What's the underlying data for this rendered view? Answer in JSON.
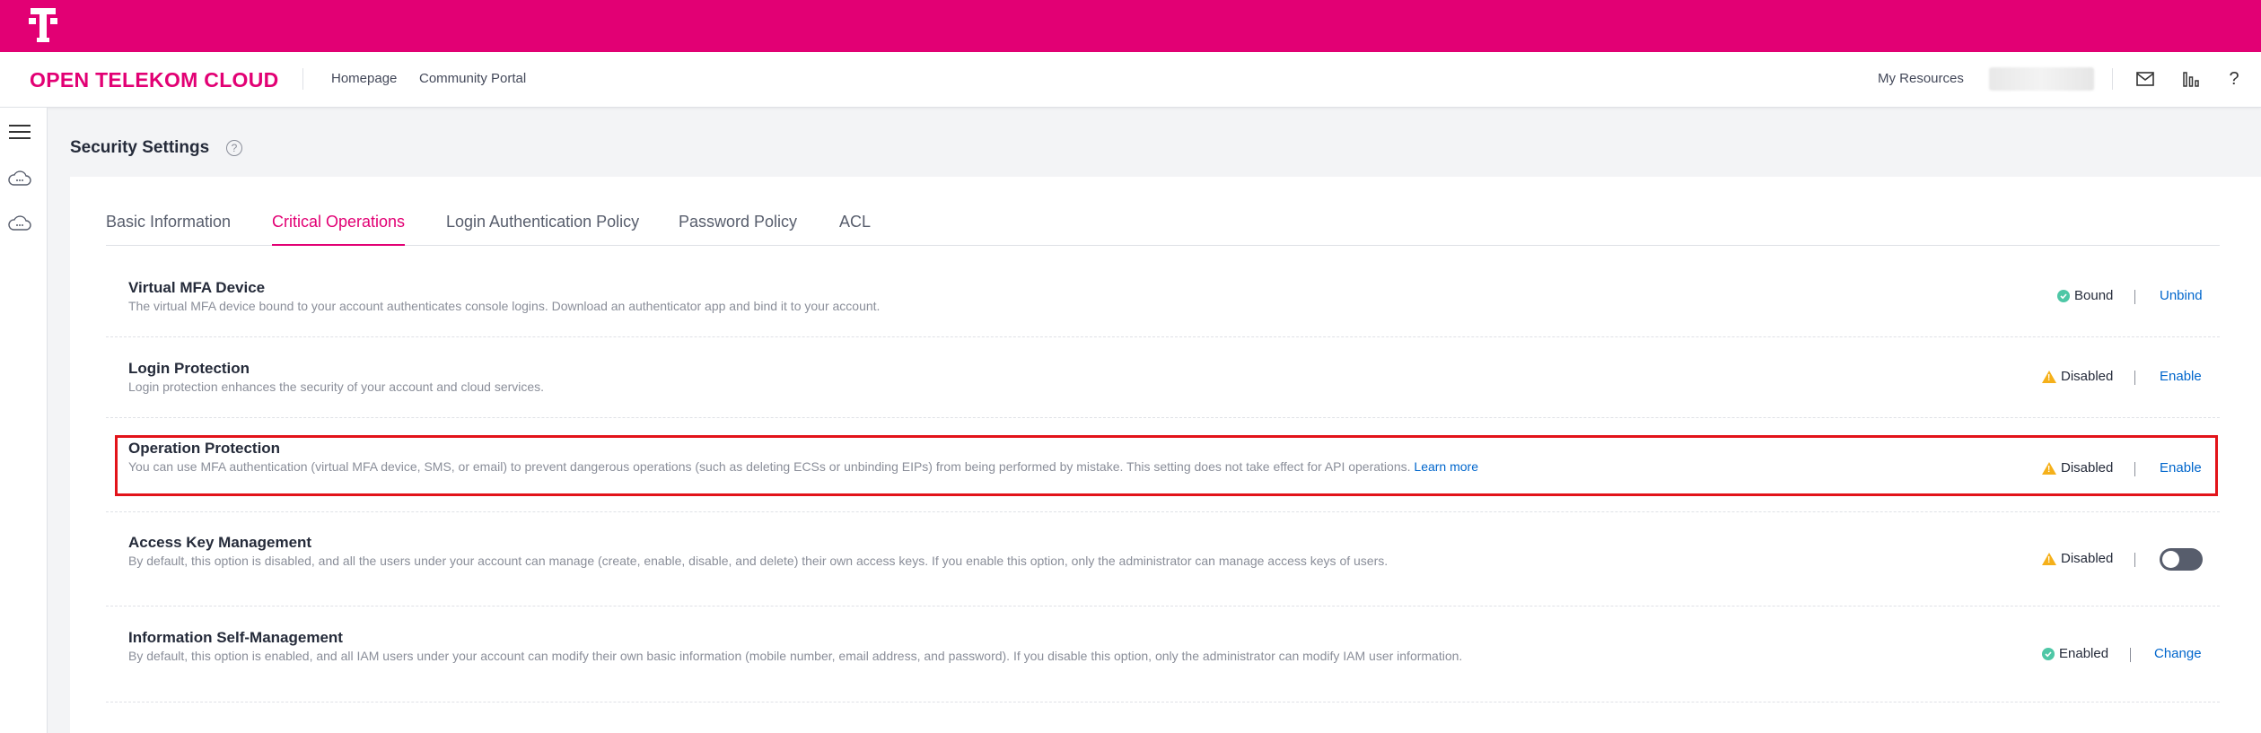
{
  "brand": {
    "logo_icon": "telekom-t-logo",
    "product_name": "OPEN TELEKOM CLOUD",
    "accent_color": "#e20074"
  },
  "header": {
    "nav": [
      "Homepage",
      "Community Portal"
    ],
    "my_resources": "My Resources",
    "icons": [
      "mail-icon",
      "bar-chart-icon",
      "help-icon"
    ]
  },
  "sidebar": {
    "icons": [
      "menu-icon",
      "cloud-icon",
      "cloud-icon"
    ]
  },
  "page": {
    "title": "Security Settings"
  },
  "tabs": [
    {
      "label": "Basic Information",
      "active": false
    },
    {
      "label": "Critical Operations",
      "active": true
    },
    {
      "label": "Login Authentication Policy",
      "active": false
    },
    {
      "label": "Password Policy",
      "active": false
    },
    {
      "label": "ACL",
      "active": false
    }
  ],
  "rows": [
    {
      "title": "Virtual MFA Device",
      "desc": "The virtual MFA device bound to your account authenticates console logins. Download an authenticator app and bind it to your account.",
      "status": "Bound",
      "status_kind": "ok",
      "action": "Unbind"
    },
    {
      "title": "Login Protection",
      "desc": "Login protection enhances the security of your account and cloud services.",
      "status": "Disabled",
      "status_kind": "warn",
      "action": "Enable"
    },
    {
      "title": "Operation Protection",
      "desc": "You can use MFA authentication (virtual MFA device, SMS, or email) to prevent dangerous operations (such as deleting ECSs or unbinding EIPs) from being performed by mistake. This setting does not take effect for API operations.",
      "learn_more": "Learn more",
      "status": "Disabled",
      "status_kind": "warn",
      "action": "Enable"
    },
    {
      "title": "Access Key Management",
      "desc": "By default, this option is disabled, and all the users under your account can manage (create, enable, disable, and delete) their own access keys. If you enable this option, only the administrator can manage access keys of users.",
      "status": "Disabled",
      "status_kind": "warn",
      "toggle_on": false
    },
    {
      "title": "Information Self-Management",
      "desc": "By default, this option is enabled, and all IAM users under your account can modify their own basic information (mobile number, email address, and password). If you disable this option, only the administrator can modify IAM user information.",
      "status": "Enabled",
      "status_kind": "ok",
      "action": "Change"
    }
  ]
}
